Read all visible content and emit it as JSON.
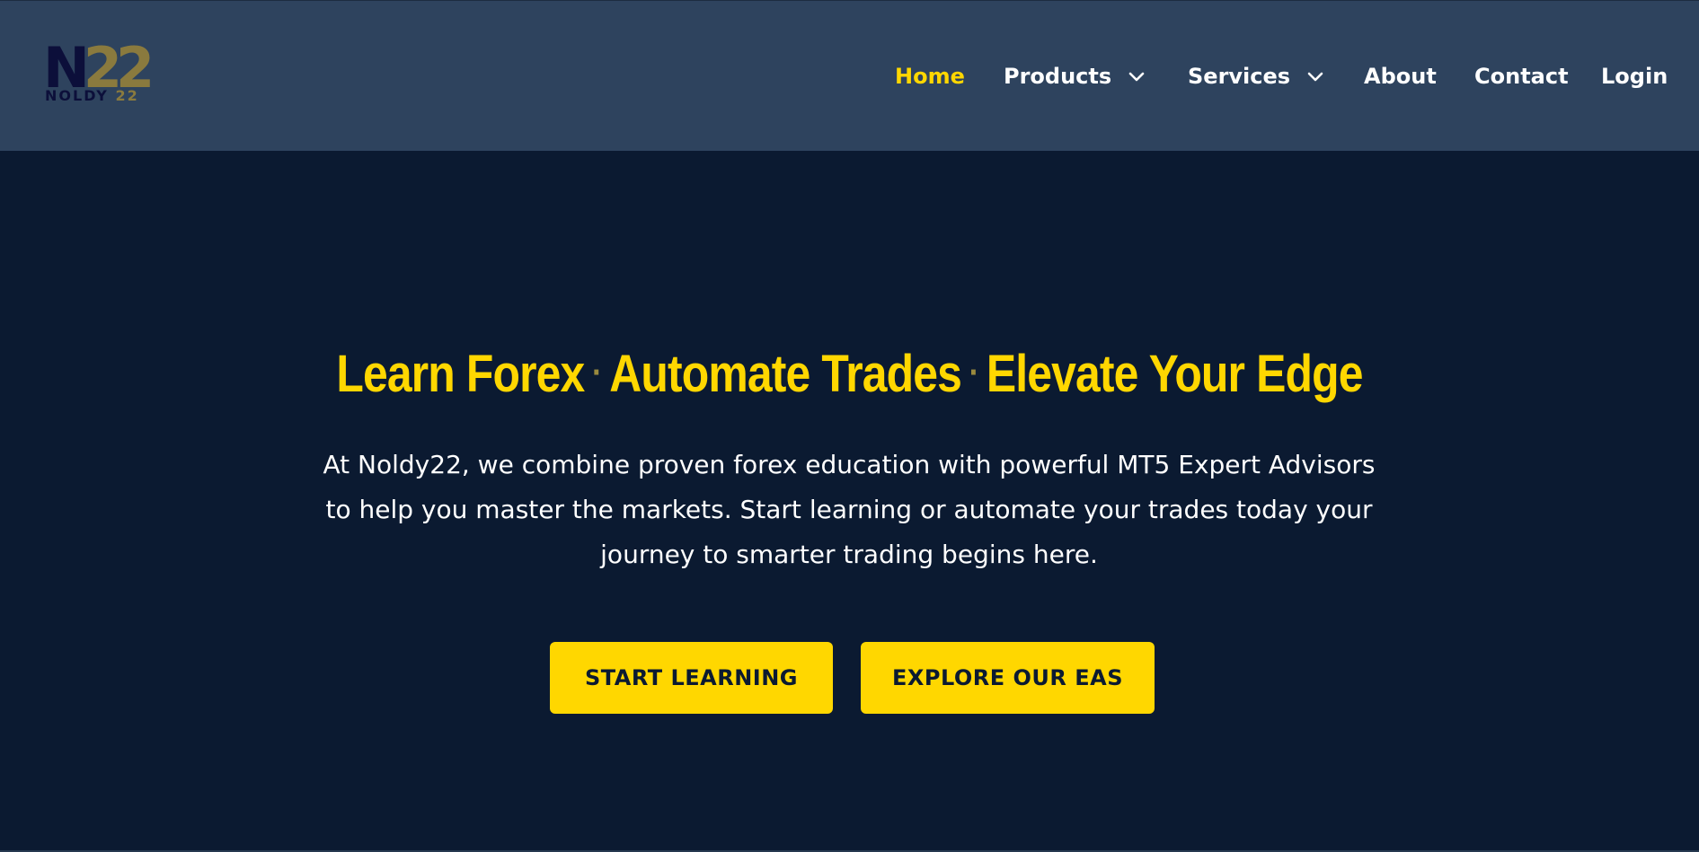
{
  "header": {
    "logo": {
      "mark_letter": "N",
      "mark_number": "22",
      "word_name": "NOLDY",
      "word_number": "22"
    },
    "nav": [
      {
        "label": "Home",
        "active": true
      },
      {
        "label": "Products",
        "has_dropdown": true,
        "icon": "chevron-down-icon"
      },
      {
        "label": "Services",
        "has_dropdown": true,
        "icon": "chevron-down-icon"
      },
      {
        "label": "About"
      },
      {
        "label": "Contact"
      },
      {
        "label": "Login"
      }
    ]
  },
  "hero": {
    "title_parts": [
      "Learn Forex",
      "Automate Trades",
      "Elevate Your Edge"
    ],
    "separator": "·",
    "description": "At Noldy22, we combine proven forex education with powerful MT5 Expert Advisors to help you master the markets. Start learning or automate your trades today your journey to smarter trading begins here.",
    "buttons": [
      {
        "label": "START LEARNING"
      },
      {
        "label": "EXPLORE OUR EAS"
      }
    ]
  },
  "colors": {
    "header_bg": "#2e435e",
    "page_bg": "#0b1a31",
    "accent": "#ffd700",
    "logo_dark": "#0c0f3a",
    "logo_gold": "#8a7a3e"
  }
}
